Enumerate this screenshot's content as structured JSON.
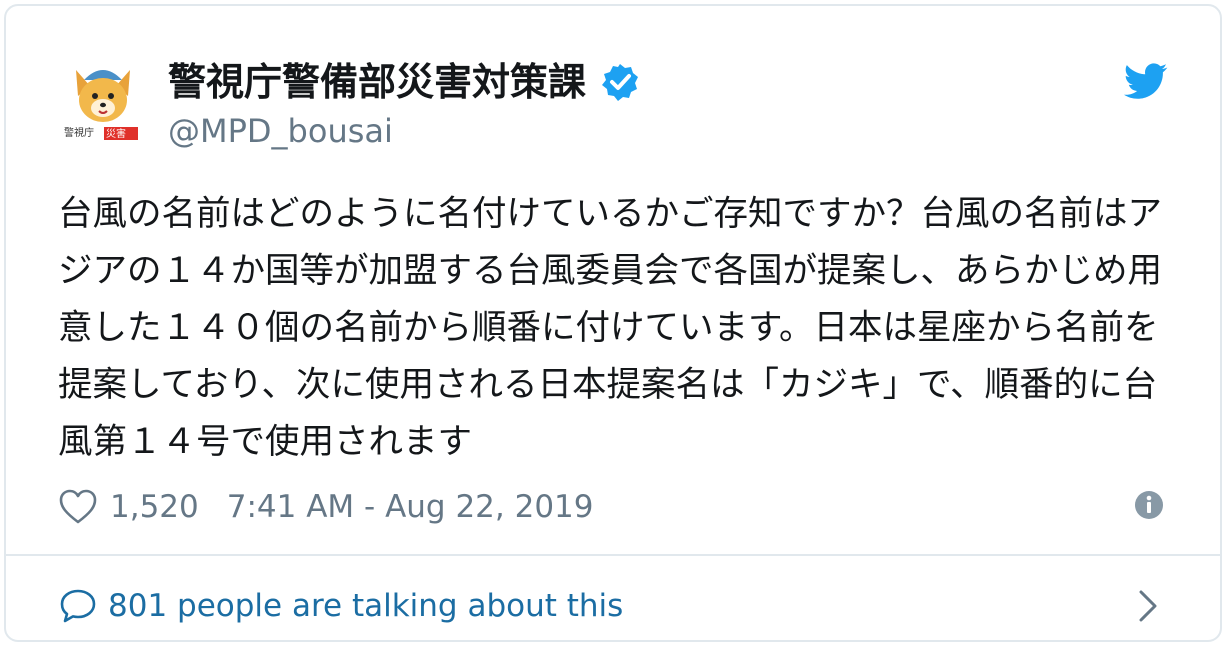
{
  "account": {
    "display_name": "警視庁警備部災害対策課",
    "handle": "@MPD_bousai",
    "avatar_caption": "警視庁災害"
  },
  "tweet": {
    "text": "台風の名前はどのように名付けているかご存知ですか？台風の名前はアジアの１４か国等が加盟する台風委員会で各国が提案し、あらかじめ用意した１４０個の名前から順番に付けています。日本は星座から名前を提案しており、次に使用される日本提案名は「カジキ」で、順番的に台風第１４号で使用されます",
    "like_count": "1,520",
    "timestamp": "7:41 AM - Aug 22, 2019"
  },
  "footer": {
    "talk_label": "801 people are talking about this"
  },
  "icons": {
    "verified": "verified-badge-icon",
    "brand": "twitter-bird-icon",
    "like": "heart-icon",
    "info": "info-icon",
    "talk": "speech-bubble-icon",
    "more": "chevron-right-icon"
  },
  "colors": {
    "brand_blue": "#1da1f2",
    "link_blue": "#1b6da3",
    "secondary_text": "#657786",
    "border": "#e1e8ed"
  }
}
